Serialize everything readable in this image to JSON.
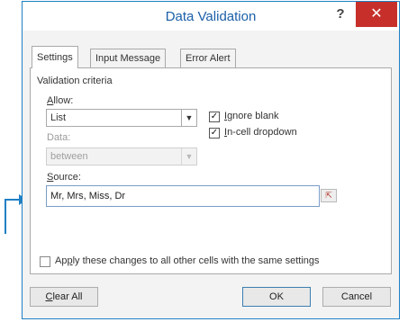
{
  "dialog": {
    "title": "Data Validation",
    "help_label": "?",
    "close_label": "✕"
  },
  "tabs": [
    {
      "label": "Settings",
      "active": true
    },
    {
      "label": "Input Message",
      "active": false
    },
    {
      "label": "Error Alert",
      "active": false
    }
  ],
  "validation": {
    "criteria_label": "Validation criteria",
    "allow": {
      "prefix": "",
      "accel": "A",
      "rest": "llow:",
      "value": "List"
    },
    "data": {
      "label": "Data:",
      "value": "between",
      "disabled": true
    },
    "ignore_blank": {
      "accel": "I",
      "rest": "gnore blank",
      "checked": true,
      "mark": "✓"
    },
    "in_cell_dropdown": {
      "accel": "I",
      "rest": "n-cell dropdown",
      "checked": true,
      "mark": "✓"
    },
    "source": {
      "accel": "S",
      "rest": "ource:",
      "value": "Mr, Mrs, Miss, Dr",
      "ref_icon": "range-select-icon",
      "ref_glyph": "⇱"
    },
    "apply_all": {
      "prefix": "Ap",
      "accel": "p",
      "rest": "ly these changes to all other cells with the same settings",
      "checked": false
    }
  },
  "buttons": {
    "clear_all": {
      "accel": "C",
      "rest": "lear All"
    },
    "ok": "OK",
    "cancel": "Cancel"
  },
  "colors": {
    "accent": "#1f7fc4",
    "close": "#c7302a",
    "title_text": "#1a5fa8"
  }
}
